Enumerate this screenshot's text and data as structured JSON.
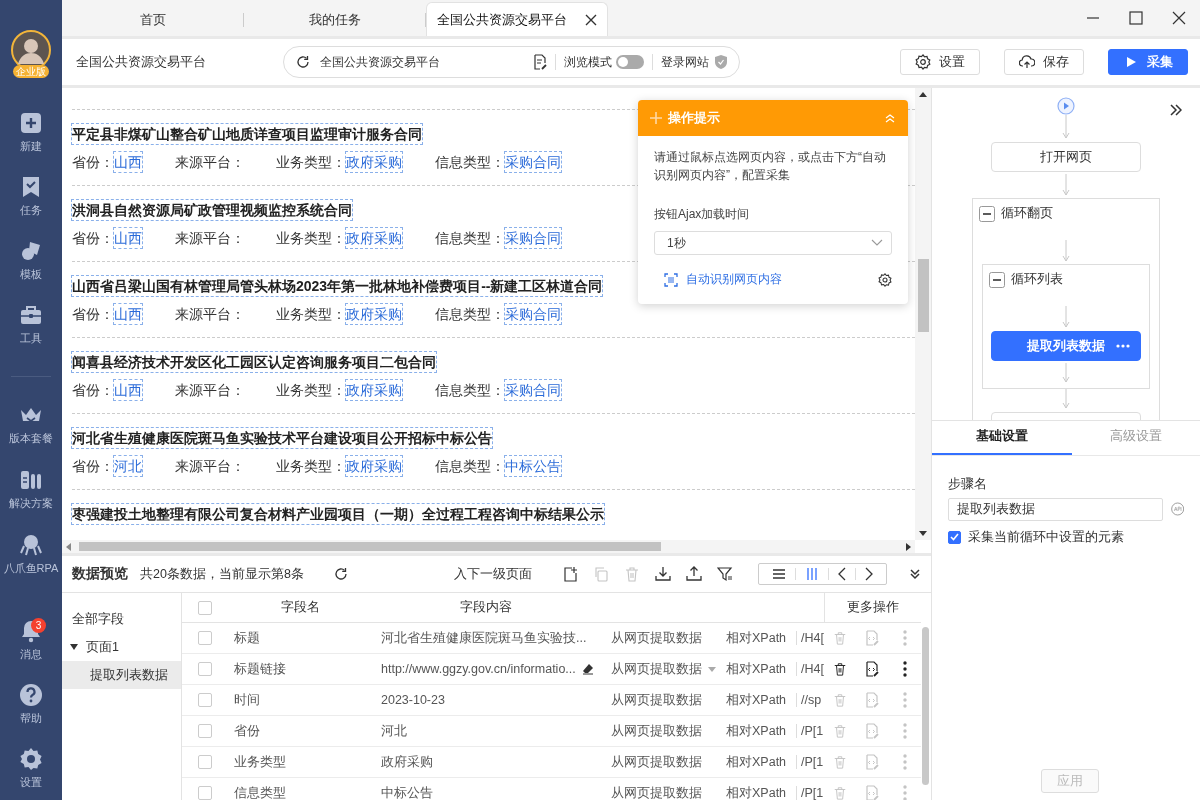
{
  "sidebar": {
    "avatar_badge": "企业版",
    "top_items": [
      {
        "kind": "new",
        "label": "新建"
      },
      {
        "kind": "task",
        "label": "任务"
      },
      {
        "kind": "template",
        "label": "模板"
      },
      {
        "kind": "tool",
        "label": "工具"
      }
    ],
    "middle_items": [
      {
        "kind": "plan",
        "label": "版本套餐"
      },
      {
        "kind": "solution",
        "label": "解决方案"
      },
      {
        "kind": "rpa",
        "label": "八爪鱼RPA"
      }
    ],
    "bottom_items": [
      {
        "kind": "message",
        "label": "消息",
        "badge": "3"
      },
      {
        "kind": "help",
        "label": "帮助"
      },
      {
        "kind": "settings",
        "label": "设置"
      }
    ]
  },
  "tabs": [
    {
      "label": "首页",
      "selected": false,
      "closable": false
    },
    {
      "label": "我的任务",
      "selected": false,
      "closable": false
    },
    {
      "label": "全国公共资源交易平台",
      "selected": true,
      "closable": true
    }
  ],
  "toolbar": {
    "page_title": "全国公共资源交易平台",
    "address": "全国公共资源交易平台",
    "browse_mode": {
      "label": "浏览模式",
      "on": false
    },
    "login_label": "登录网站",
    "buttons": [
      {
        "kind": "settings",
        "label": "设置"
      },
      {
        "kind": "save",
        "label": "保存"
      },
      {
        "kind": "run",
        "label": "采集"
      }
    ]
  },
  "web_list": {
    "items": [
      {
        "title": "平定县非煤矿山整合矿山地质详查项目监理审计服务合同",
        "fields": [
          {
            "label": "省份：",
            "value": "山西"
          },
          {
            "label": "来源平台："
          },
          {
            "label": "业务类型：",
            "value": "政府采购"
          },
          {
            "label": "信息类型：",
            "value": "采购合同"
          }
        ]
      },
      {
        "title": "洪洞县自然资源局矿政管理视频监控系统合同",
        "fields": [
          {
            "label": "省份：",
            "value": "山西"
          },
          {
            "label": "来源平台："
          },
          {
            "label": "业务类型：",
            "value": "政府采购"
          },
          {
            "label": "信息类型：",
            "value": "采购合同"
          }
        ]
      },
      {
        "title": "山西省吕梁山国有林管理局管头林场2023年第一批林地补偿费项目--新建工区林道合同",
        "fields": [
          {
            "label": "省份：",
            "value": "山西"
          },
          {
            "label": "来源平台："
          },
          {
            "label": "业务类型：",
            "value": "政府采购"
          },
          {
            "label": "信息类型：",
            "value": "采购合同"
          }
        ]
      },
      {
        "title": "闻喜县经济技术开发区化工园区认定咨询服务项目二包合同",
        "fields": [
          {
            "label": "省份：",
            "value": "山西"
          },
          {
            "label": "来源平台："
          },
          {
            "label": "业务类型：",
            "value": "政府采购"
          },
          {
            "label": "信息类型：",
            "value": "采购合同"
          }
        ]
      },
      {
        "title": "河北省生殖健康医院斑马鱼实验技术平台建设项目公开招标中标公告",
        "fields": [
          {
            "label": "省份：",
            "value": "河北"
          },
          {
            "label": "来源平台："
          },
          {
            "label": "业务类型：",
            "value": "政府采购"
          },
          {
            "label": "信息类型：",
            "value": "中标公告"
          }
        ]
      },
      {
        "title": "枣强建投土地整理有限公司复合材料产业园项目（一期）全过程工程咨询中标结果公示"
      }
    ]
  },
  "tip": {
    "title": "操作提示",
    "text": "请通过鼠标点选网页内容，或点击下方“自动识别网页内容”，配置采集",
    "ajax_label": "按钮Ajax加载时间",
    "ajax_value": "1秒",
    "auto_link": "自动识别网页内容"
  },
  "flow": {
    "open_node": "打开网页",
    "page_loop": {
      "label": "循环翻页",
      "expanded": true
    },
    "list_loop": {
      "label": "循环列表",
      "expanded": true
    },
    "extract_node": {
      "label": "提取列表数据",
      "selected": true
    }
  },
  "settings": {
    "tabs": [
      {
        "label": "基础设置",
        "selected": true
      },
      {
        "label": "高级设置",
        "selected": false
      }
    ],
    "step_label": "步骤名",
    "step_value": "提取列表数据",
    "option": {
      "label": "采集当前循环中设置的元素",
      "checked": true
    },
    "apply": {
      "label": "应用",
      "disabled": true
    }
  },
  "preview": {
    "title": "数据预览",
    "summary": "共20条数据，当前显示第8条",
    "next_level": "入下一级页面",
    "tools": [
      {
        "kind": "add",
        "disabled": false
      },
      {
        "kind": "copy",
        "disabled": true
      },
      {
        "kind": "delete",
        "disabled": true
      },
      {
        "kind": "download",
        "disabled": false
      },
      {
        "kind": "upload",
        "disabled": false
      },
      {
        "kind": "filter",
        "disabled": false
      }
    ],
    "view_modes": [
      {
        "kind": "list",
        "selected": false
      },
      {
        "kind": "columns",
        "selected": true
      }
    ],
    "tree": {
      "root": "全部字段",
      "pages": [
        {
          "label": "页面1",
          "expanded": true,
          "children": [
            {
              "label": "提取列表数据",
              "selected": true
            }
          ]
        }
      ]
    },
    "all_checked": false,
    "columns": [
      "字段名",
      "字段内容",
      "更多操作"
    ],
    "rows": [
      {
        "name": "标题",
        "content": "河北省生殖健康医院斑马鱼实验技...",
        "method": "从网页提取数据",
        "xpath_type": "相对XPath",
        "xpath": "/H4[",
        "hovered": false,
        "checked": false
      },
      {
        "name": "标题链接",
        "content": "http://www.ggzy.gov.cn/informatio...",
        "method": "从网页提取数据",
        "xpath_type": "相对XPath",
        "xpath": "/H4[",
        "hovered": true,
        "checked": false
      },
      {
        "name": "时间",
        "content": "2023-10-23",
        "method": "从网页提取数据",
        "xpath_type": "相对XPath",
        "xpath": "//sp",
        "hovered": false,
        "checked": false
      },
      {
        "name": "省份",
        "content": "河北",
        "method": "从网页提取数据",
        "xpath_type": "相对XPath",
        "xpath": "/P[1",
        "hovered": false,
        "checked": false
      },
      {
        "name": "业务类型",
        "content": "政府采购",
        "method": "从网页提取数据",
        "xpath_type": "相对XPath",
        "xpath": "/P[1",
        "hovered": false,
        "checked": false
      },
      {
        "name": "信息类型",
        "content": "中标公告",
        "method": "从网页提取数据",
        "xpath_type": "相对XPath",
        "xpath": "/P[1",
        "hovered": false,
        "checked": false
      }
    ]
  }
}
